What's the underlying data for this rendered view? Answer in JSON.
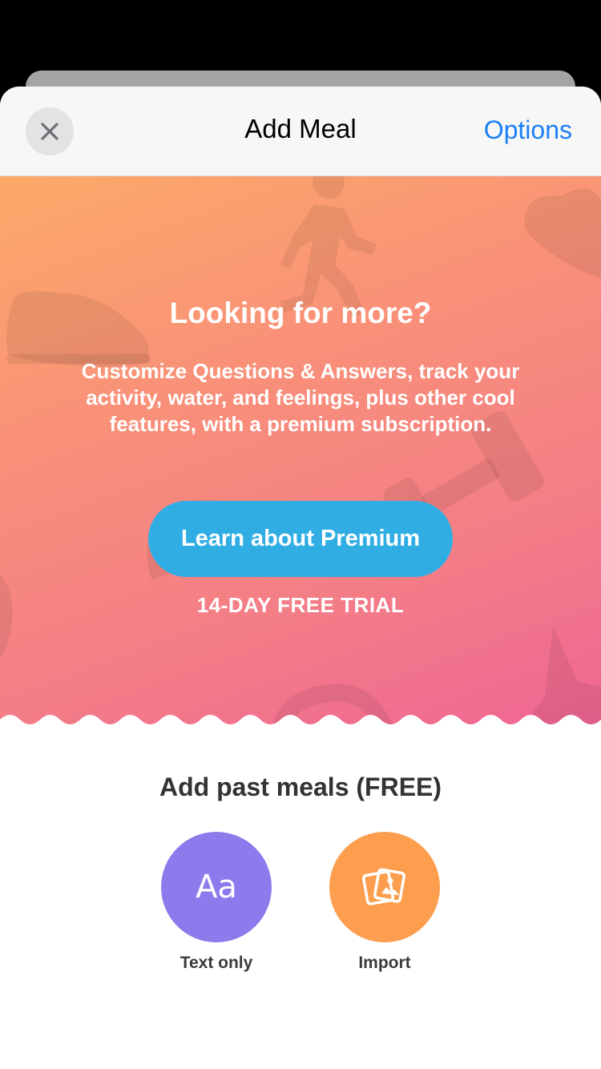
{
  "header": {
    "title": "Add Meal",
    "options_label": "Options",
    "close_icon": "close-icon"
  },
  "promo": {
    "title": "Looking for more?",
    "body": "Customize Questions & Answers, track your activity, water, and feelings, plus other cool features, with a premium subscription.",
    "cta_label": "Learn about Premium",
    "trial_label": "14-DAY FREE TRIAL",
    "background_icons": [
      "sneaker-icon",
      "runner-icon",
      "heart-icon",
      "dumbbell-icon",
      "apple-icon",
      "star-icon"
    ]
  },
  "past_meals": {
    "title": "Add past meals (FREE)",
    "options": [
      {
        "label": "Text only",
        "glyph": "Aa",
        "icon": "text-icon",
        "color": "#8c7bec"
      },
      {
        "label": "Import",
        "icon": "photos-icon",
        "color": "#fc9e4d"
      }
    ]
  },
  "colors": {
    "accent_blue": "#1a7ff5",
    "cta_blue": "#30aee4",
    "gradient_start": "#fca968",
    "gradient_end": "#ef6494"
  }
}
